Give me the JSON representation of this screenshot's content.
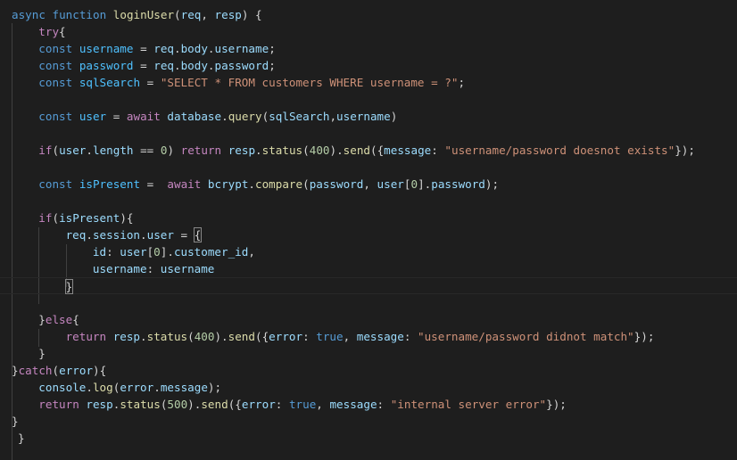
{
  "editor": {
    "language": "javascript",
    "theme_colors": {
      "background": "#1e1e1e",
      "keyword": "#569cd6",
      "control": "#c586c0",
      "function": "#dcdcaa",
      "variable": "#9cdcfe",
      "string": "#ce9178",
      "number": "#b5cea8"
    },
    "lines": [
      {
        "indent": 0,
        "tokens": [
          [
            "kw",
            "async"
          ],
          [
            "punc",
            " "
          ],
          [
            "kw",
            "function"
          ],
          [
            "punc",
            " "
          ],
          [
            "fn",
            "loginUser"
          ],
          [
            "punc",
            "("
          ],
          [
            "var",
            "req"
          ],
          [
            "punc",
            ", "
          ],
          [
            "var",
            "resp"
          ],
          [
            "punc",
            ") {"
          ]
        ]
      },
      {
        "indent": 1,
        "tokens": [
          [
            "ctrl",
            "try"
          ],
          [
            "punc",
            "{"
          ]
        ]
      },
      {
        "indent": 1,
        "tokens": [
          [
            "kw",
            "const"
          ],
          [
            "punc",
            " "
          ],
          [
            "const",
            "username"
          ],
          [
            "punc",
            " = "
          ],
          [
            "var",
            "req"
          ],
          [
            "punc",
            "."
          ],
          [
            "var",
            "body"
          ],
          [
            "punc",
            "."
          ],
          [
            "var",
            "username"
          ],
          [
            "punc",
            ";"
          ]
        ]
      },
      {
        "indent": 1,
        "tokens": [
          [
            "kw",
            "const"
          ],
          [
            "punc",
            " "
          ],
          [
            "const",
            "password"
          ],
          [
            "punc",
            " = "
          ],
          [
            "var",
            "req"
          ],
          [
            "punc",
            "."
          ],
          [
            "var",
            "body"
          ],
          [
            "punc",
            "."
          ],
          [
            "var",
            "password"
          ],
          [
            "punc",
            ";"
          ]
        ]
      },
      {
        "indent": 1,
        "tokens": [
          [
            "kw",
            "const"
          ],
          [
            "punc",
            " "
          ],
          [
            "const",
            "sqlSearch"
          ],
          [
            "punc",
            " = "
          ],
          [
            "str",
            "\"SELECT * FROM customers WHERE username = ?\""
          ],
          [
            "punc",
            ";"
          ]
        ]
      },
      {
        "indent": 0,
        "tokens": []
      },
      {
        "indent": 1,
        "tokens": [
          [
            "kw",
            "const"
          ],
          [
            "punc",
            " "
          ],
          [
            "const",
            "user"
          ],
          [
            "punc",
            " = "
          ],
          [
            "ctrl",
            "await"
          ],
          [
            "punc",
            " "
          ],
          [
            "var",
            "database"
          ],
          [
            "punc",
            "."
          ],
          [
            "fn",
            "query"
          ],
          [
            "punc",
            "("
          ],
          [
            "var",
            "sqlSearch"
          ],
          [
            "punc",
            ","
          ],
          [
            "var",
            "username"
          ],
          [
            "punc",
            ")"
          ]
        ]
      },
      {
        "indent": 0,
        "tokens": []
      },
      {
        "indent": 1,
        "tokens": [
          [
            "ctrl",
            "if"
          ],
          [
            "punc",
            "("
          ],
          [
            "var",
            "user"
          ],
          [
            "punc",
            "."
          ],
          [
            "var",
            "length"
          ],
          [
            "punc",
            " == "
          ],
          [
            "num",
            "0"
          ],
          [
            "punc",
            ") "
          ],
          [
            "ctrl",
            "return"
          ],
          [
            "punc",
            " "
          ],
          [
            "var",
            "resp"
          ],
          [
            "punc",
            "."
          ],
          [
            "fn",
            "status"
          ],
          [
            "punc",
            "("
          ],
          [
            "num",
            "400"
          ],
          [
            "punc",
            ")."
          ],
          [
            "fn",
            "send"
          ],
          [
            "punc",
            "({"
          ],
          [
            "var",
            "message"
          ],
          [
            "punc",
            ": "
          ],
          [
            "str",
            "\"username/password doesnot exists\""
          ],
          [
            "punc",
            "});"
          ]
        ]
      },
      {
        "indent": 0,
        "tokens": []
      },
      {
        "indent": 1,
        "tokens": [
          [
            "kw",
            "const"
          ],
          [
            "punc",
            " "
          ],
          [
            "const",
            "isPresent"
          ],
          [
            "punc",
            " =  "
          ],
          [
            "ctrl",
            "await"
          ],
          [
            "punc",
            " "
          ],
          [
            "var",
            "bcrypt"
          ],
          [
            "punc",
            "."
          ],
          [
            "fn",
            "compare"
          ],
          [
            "punc",
            "("
          ],
          [
            "var",
            "password"
          ],
          [
            "punc",
            ", "
          ],
          [
            "var",
            "user"
          ],
          [
            "punc",
            "["
          ],
          [
            "num",
            "0"
          ],
          [
            "punc",
            "]."
          ],
          [
            "var",
            "password"
          ],
          [
            "punc",
            ");"
          ]
        ]
      },
      {
        "indent": 0,
        "tokens": []
      },
      {
        "indent": 1,
        "tokens": [
          [
            "ctrl",
            "if"
          ],
          [
            "punc",
            "("
          ],
          [
            "var",
            "isPresent"
          ],
          [
            "punc",
            "){"
          ]
        ]
      },
      {
        "indent": 2,
        "tokens": [
          [
            "var",
            "req"
          ],
          [
            "punc",
            "."
          ],
          [
            "var",
            "session"
          ],
          [
            "punc",
            "."
          ],
          [
            "var",
            "user"
          ],
          [
            "punc",
            " = "
          ],
          [
            "match",
            "{"
          ]
        ]
      },
      {
        "indent": 3,
        "tokens": [
          [
            "var",
            "id"
          ],
          [
            "punc",
            ": "
          ],
          [
            "var",
            "user"
          ],
          [
            "punc",
            "["
          ],
          [
            "num",
            "0"
          ],
          [
            "punc",
            "]."
          ],
          [
            "var",
            "customer_id"
          ],
          [
            "punc",
            ","
          ]
        ]
      },
      {
        "indent": 3,
        "tokens": [
          [
            "var",
            "username"
          ],
          [
            "punc",
            ": "
          ],
          [
            "var",
            "username"
          ]
        ]
      },
      {
        "indent": 2,
        "tokens": [
          [
            "match",
            "}"
          ]
        ],
        "current": true
      },
      {
        "indent": 0,
        "tokens": []
      },
      {
        "indent": 1,
        "tokens": [
          [
            "punc",
            "}"
          ],
          [
            "ctrl",
            "else"
          ],
          [
            "punc",
            "{"
          ]
        ]
      },
      {
        "indent": 2,
        "tokens": [
          [
            "ctrl",
            "return"
          ],
          [
            "punc",
            " "
          ],
          [
            "var",
            "resp"
          ],
          [
            "punc",
            "."
          ],
          [
            "fn",
            "status"
          ],
          [
            "punc",
            "("
          ],
          [
            "num",
            "400"
          ],
          [
            "punc",
            ")."
          ],
          [
            "fn",
            "send"
          ],
          [
            "punc",
            "({"
          ],
          [
            "var",
            "error"
          ],
          [
            "punc",
            ": "
          ],
          [
            "kw",
            "true"
          ],
          [
            "punc",
            ", "
          ],
          [
            "var",
            "message"
          ],
          [
            "punc",
            ": "
          ],
          [
            "str",
            "\"username/password didnot match\""
          ],
          [
            "punc",
            "});"
          ]
        ]
      },
      {
        "indent": 1,
        "tokens": [
          [
            "punc",
            "}"
          ]
        ]
      },
      {
        "indent": 0,
        "tokens": [
          [
            "punc",
            "}"
          ],
          [
            "ctrl",
            "catch"
          ],
          [
            "punc",
            "("
          ],
          [
            "var",
            "error"
          ],
          [
            "punc",
            "){"
          ]
        ]
      },
      {
        "indent": 1,
        "tokens": [
          [
            "var",
            "console"
          ],
          [
            "punc",
            "."
          ],
          [
            "fn",
            "log"
          ],
          [
            "punc",
            "("
          ],
          [
            "var",
            "error"
          ],
          [
            "punc",
            "."
          ],
          [
            "var",
            "message"
          ],
          [
            "punc",
            ");"
          ]
        ]
      },
      {
        "indent": 1,
        "tokens": [
          [
            "ctrl",
            "return"
          ],
          [
            "punc",
            " "
          ],
          [
            "var",
            "resp"
          ],
          [
            "punc",
            "."
          ],
          [
            "fn",
            "status"
          ],
          [
            "punc",
            "("
          ],
          [
            "num",
            "500"
          ],
          [
            "punc",
            ")."
          ],
          [
            "fn",
            "send"
          ],
          [
            "punc",
            "({"
          ],
          [
            "var",
            "error"
          ],
          [
            "punc",
            ": "
          ],
          [
            "kw",
            "true"
          ],
          [
            "punc",
            ", "
          ],
          [
            "var",
            "message"
          ],
          [
            "punc",
            ": "
          ],
          [
            "str",
            "\"internal server error\""
          ],
          [
            "punc",
            "});"
          ]
        ]
      },
      {
        "indent": 0,
        "tokens": [
          [
            "punc",
            "}"
          ]
        ]
      },
      {
        "indent": 0,
        "prefix": " ",
        "tokens": [
          [
            "punc",
            "}"
          ]
        ]
      }
    ]
  }
}
